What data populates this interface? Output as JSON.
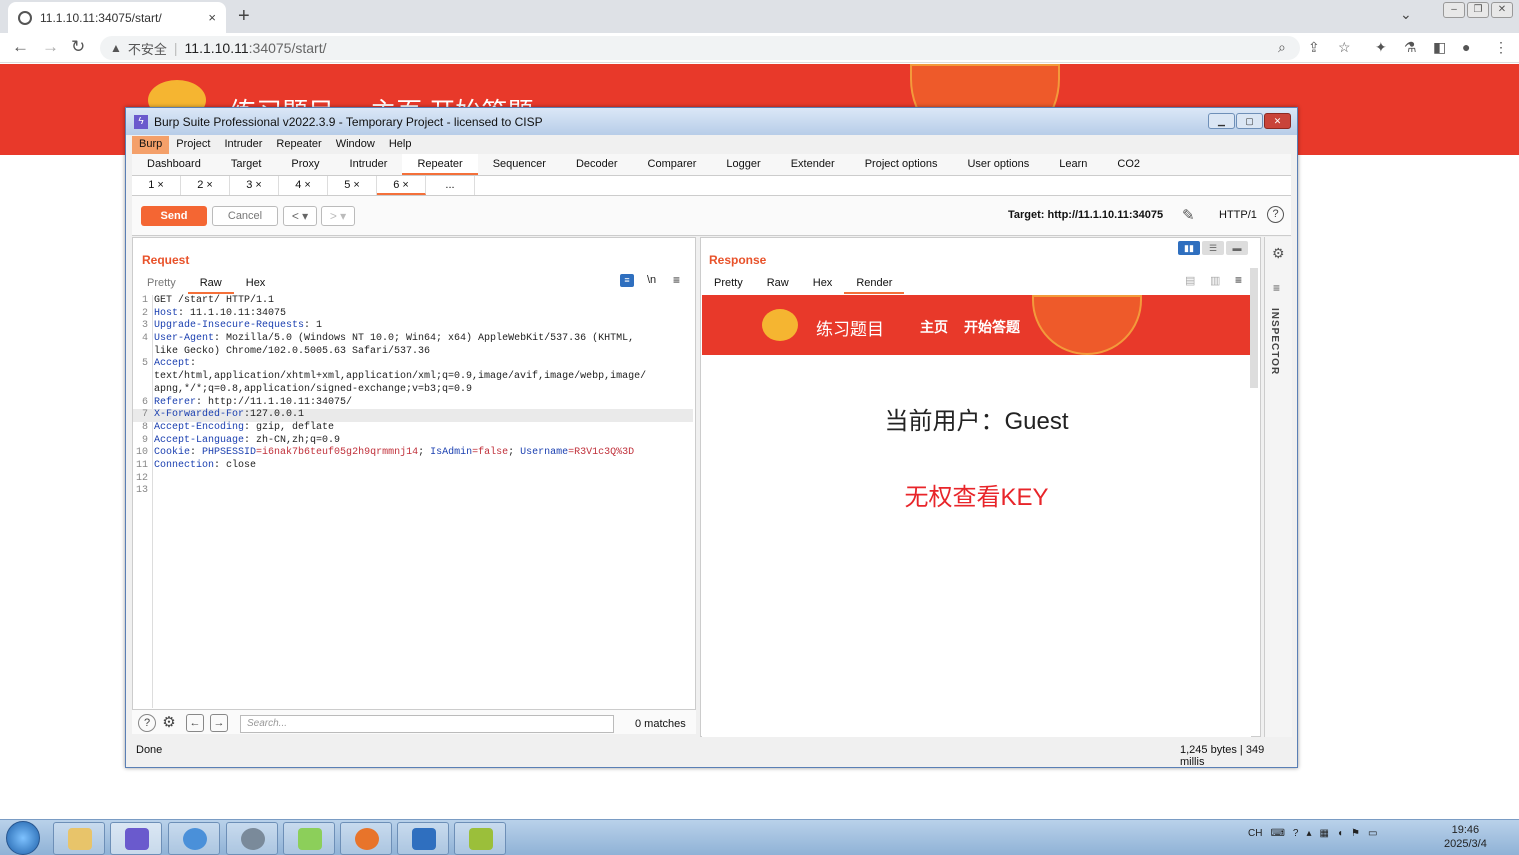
{
  "browser": {
    "tab_title": "11.1.10.11:34075/start/",
    "tab_close": "×",
    "new_tab": "+",
    "insecure_label": "不安全",
    "url_host": "11.1.10.11",
    "url_rest": ":34075/start/"
  },
  "page": {
    "banner_title": "练习题目",
    "banner_nav": "主页  开始答题"
  },
  "burp": {
    "title": "Burp Suite Professional v2022.3.9 - Temporary Project - licensed to CISP",
    "menu": [
      "Burp",
      "Project",
      "Intruder",
      "Repeater",
      "Window",
      "Help"
    ],
    "tools": [
      "Dashboard",
      "Target",
      "Proxy",
      "Intruder",
      "Repeater",
      "Sequencer",
      "Decoder",
      "Comparer",
      "Logger",
      "Extender",
      "Project options",
      "User options",
      "Learn",
      "CO2"
    ],
    "active_tool": "Repeater",
    "subtabs": [
      "1 ×",
      "2 ×",
      "3 ×",
      "4 ×",
      "5 ×",
      "6 ×",
      "..."
    ],
    "send": "Send",
    "cancel": "Cancel",
    "target_label": "Target: http://11.1.10.11:34075",
    "http_version": "HTTP/1",
    "request": {
      "heading": "Request",
      "tabs": [
        "Pretty",
        "Raw",
        "Hex"
      ],
      "active_tab": "Raw",
      "toggle_ln": "\\n",
      "line_numbers": [
        "1",
        "2",
        "3",
        "4",
        "",
        "5",
        "",
        "",
        "6",
        "7",
        "8",
        "9",
        "10",
        "11",
        "12",
        "13"
      ],
      "lines": [
        {
          "k": "",
          "v": "GET /start/ HTTP/1.1"
        },
        {
          "k": "Host",
          "v": ": 11.1.10.11:34075"
        },
        {
          "k": "Upgrade-Insecure-Requests",
          "v": ": 1"
        },
        {
          "k": "User-Agent",
          "v": ": Mozilla/5.0 (Windows NT 10.0; Win64; x64) AppleWebKit/537.36 (KHTML,"
        },
        {
          "k": "",
          "v": "like Gecko) Chrome/102.0.5005.63 Safari/537.36"
        },
        {
          "k": "Accept",
          "v": ":"
        },
        {
          "k": "",
          "v": "text/html,application/xhtml+xml,application/xml;q=0.9,image/avif,image/webp,image/"
        },
        {
          "k": "",
          "v": "apng,*/*;q=0.8,application/signed-exchange;v=b3;q=0.9"
        },
        {
          "k": "Referer",
          "v": ": http://11.1.10.11:34075/"
        },
        {
          "k": "X-Forwarded-For",
          "v": ":127.0.0.1"
        },
        {
          "k": "Accept-Encoding",
          "v": ": gzip, deflate"
        },
        {
          "k": "Accept-Language",
          "v": ": zh-CN,zh;q=0.9"
        },
        {
          "k": "Cookie",
          "v": ": "
        },
        {
          "k": "Connection",
          "v": ": close"
        },
        {
          "k": "",
          "v": ""
        },
        {
          "k": "",
          "v": ""
        }
      ],
      "cookie": {
        "phpsessid_key": "PHPSESSID",
        "phpsessid_val": "=i6nak7b6teuf05g2h9qrmmnj14",
        "sep1": "; ",
        "isadmin_key": "IsAdmin",
        "isadmin_val": "=false",
        "sep2": "; ",
        "username_key": "Username",
        "username_val": "=R3V1c3Q%3D"
      }
    },
    "search_placeholder": "Search...",
    "matches": "0 matches",
    "response": {
      "heading": "Response",
      "tabs": [
        "Pretty",
        "Raw",
        "Hex",
        "Render"
      ],
      "active_tab": "Render",
      "render": {
        "title": "练习题目",
        "home": "主页",
        "start": "开始答题",
        "user_line": "当前用户：Guest",
        "key_line": "无权查看KEY"
      }
    },
    "inspector": "INSPECTOR",
    "status_left": "Done",
    "status_right": "1,245 bytes | 349 millis"
  },
  "taskbar": {
    "ime": "CH",
    "time": "19:46",
    "date": "2025/3/4"
  }
}
